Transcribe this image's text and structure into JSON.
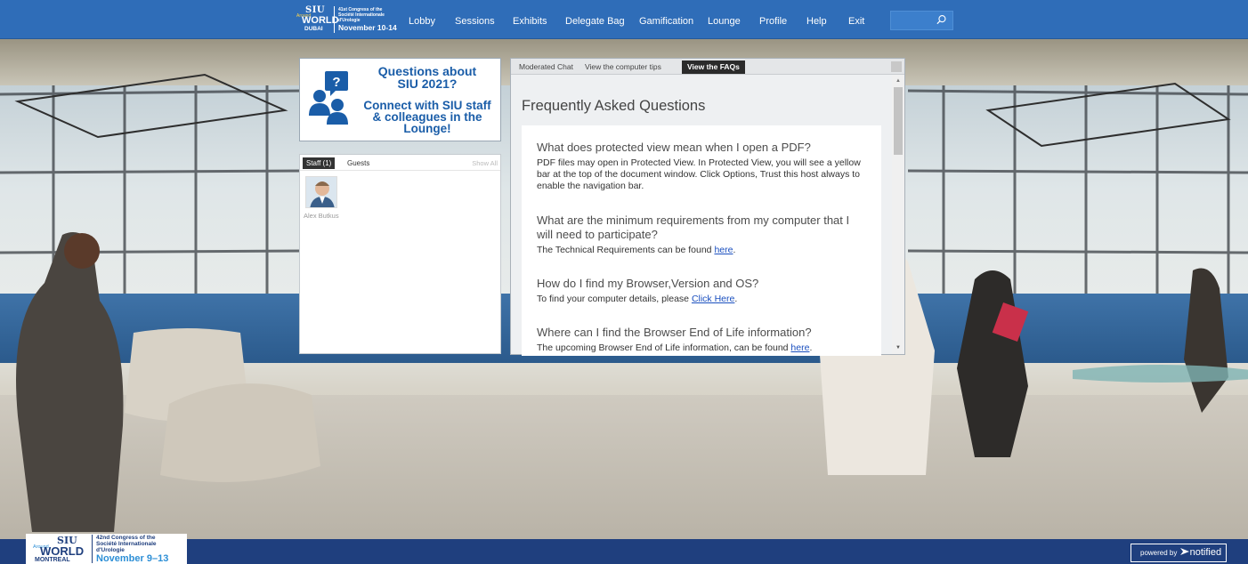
{
  "header": {
    "logo": {
      "siu": "SIU",
      "around": "Around",
      "world": "WORLD",
      "city": "DUBAI",
      "congress_line": "41st Congress of the",
      "society_line1": "Société Internationale",
      "society_line2": "d'Urologie",
      "dates": "November 10-14"
    },
    "nav": [
      "Lobby",
      "Sessions",
      "Exhibits",
      "Delegate Bag",
      "Gamification",
      "Lounge",
      "Profile",
      "Help",
      "Exit"
    ],
    "search": {
      "value": "",
      "placeholder": ""
    },
    "colors": {
      "bar": "#2f6db8",
      "footer": "#1f3f7e",
      "accent": "#1a5da8"
    }
  },
  "promo": {
    "title_line1": "Questions about",
    "title_line2": "SIU 2021?",
    "body_line1": "Connect with SIU staff",
    "body_line2": "& colleagues in the",
    "body_line3": "Lounge!"
  },
  "attendees": {
    "tabs": [
      "Staff (1)",
      "Guests"
    ],
    "active_tab": "Staff (1)",
    "show_all": "Show All",
    "people": [
      {
        "name": "Alex Butkus"
      }
    ]
  },
  "faq_window": {
    "tabs": [
      "Moderated Chat",
      "View the computer tips",
      "View the FAQs"
    ],
    "active_tab": "View the FAQs",
    "title": "Frequently Asked Questions",
    "items": [
      {
        "question": "What does protected view mean when I open a PDF?",
        "answer": "PDF files may open in Protected View. In Protected View, you will see a yellow bar at the top of the document window. Click Options, Trust this host always to enable the navigation bar."
      },
      {
        "question": "What are the minimum requirements from my computer that I will need to participate?",
        "answer": "The Technical Requirements can be found ",
        "link": "here",
        "suffix": "."
      },
      {
        "question": "How do I find my Browser,Version and OS?",
        "answer": "To find your computer details, please ",
        "link": "Click Here",
        "suffix": "."
      },
      {
        "question": "Where can I find the Browser End of Life information?",
        "answer": "The upcoming Browser End of Life information, can be found ",
        "link": "here",
        "suffix": "."
      }
    ]
  },
  "footer": {
    "logo": {
      "siu": "SIU",
      "around": "Around",
      "world": "WORLD",
      "city": "MONTREAL",
      "congress_line1": "42nd Congress of the",
      "congress_line2": "Société Internationale",
      "congress_line3": "d'Urologie",
      "dates": "November 9–13"
    },
    "powered_by": "powered by",
    "brand": "notified"
  }
}
